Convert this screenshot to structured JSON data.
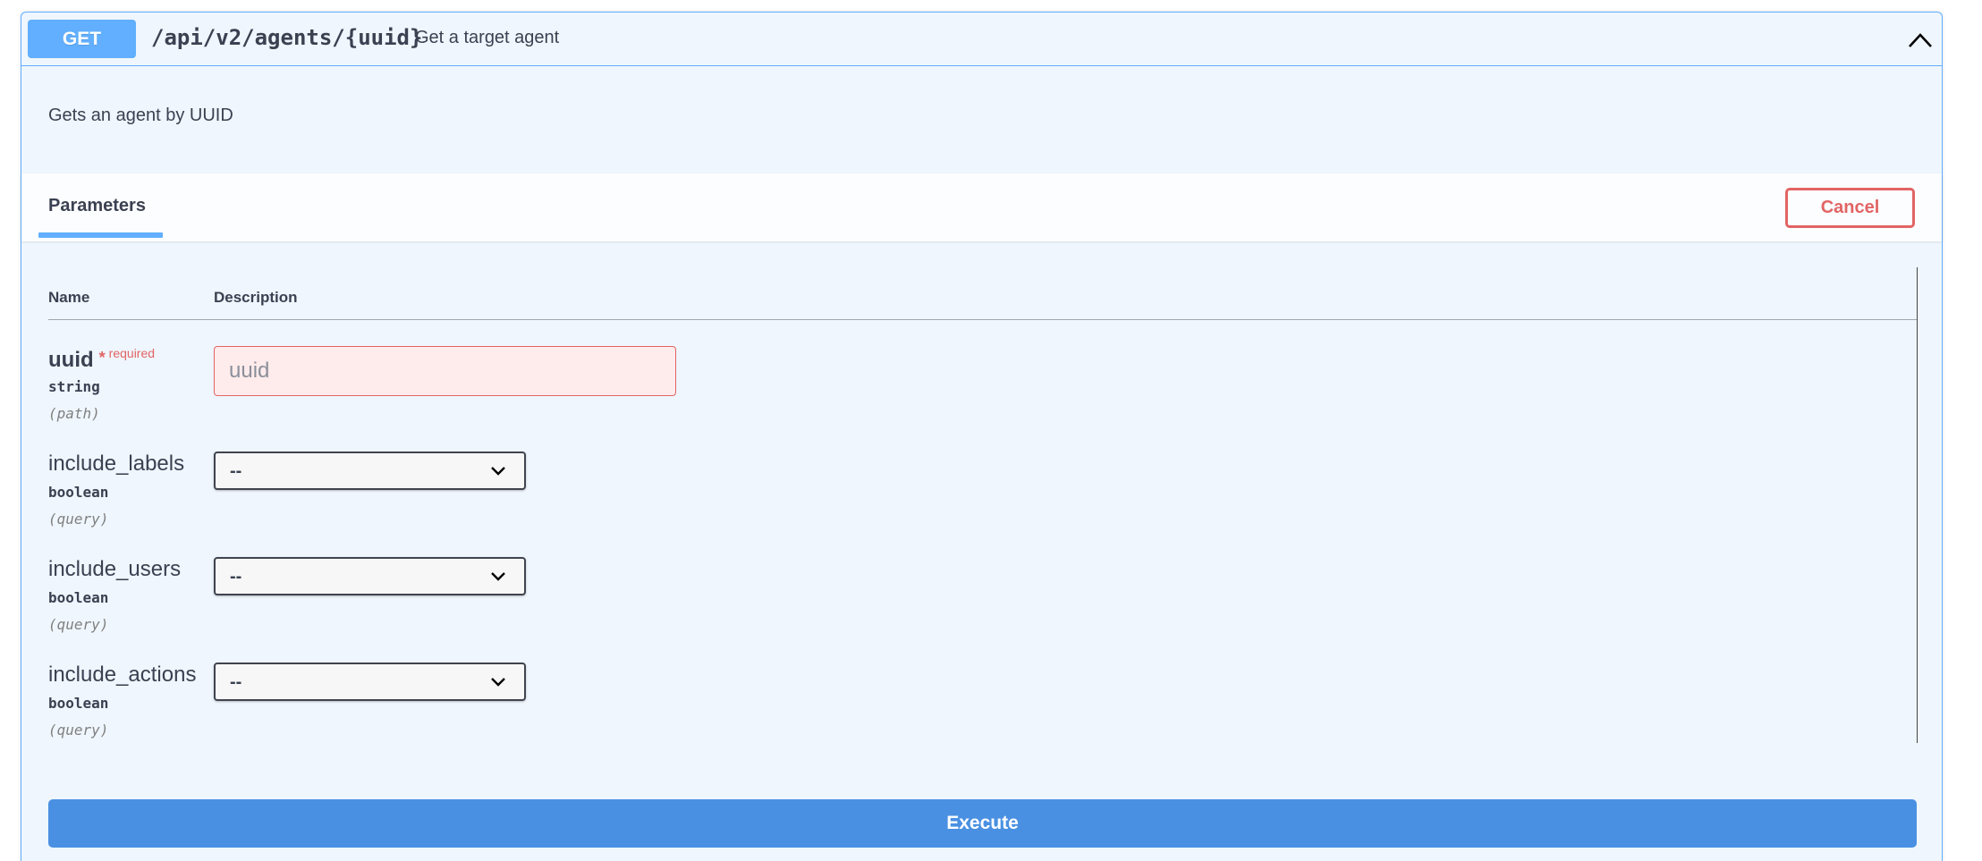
{
  "summary": {
    "method": "GET",
    "path": "/api/v2/agents/{uuid}",
    "description": "Get a target agent",
    "collapse_icon": "chevron-up-icon"
  },
  "description": "Gets an agent by UUID",
  "tabs": {
    "parameters_label": "Parameters",
    "cancel_label": "Cancel"
  },
  "table": {
    "col_name": "Name",
    "col_description": "Description"
  },
  "parameters": [
    {
      "name": "uuid",
      "required_star": "*",
      "required_label": "required",
      "type": "string",
      "in": "(path)",
      "placeholder": "uuid"
    },
    {
      "name": "include_labels",
      "type": "boolean",
      "in": "(query)",
      "value": "--"
    },
    {
      "name": "include_users",
      "type": "boolean",
      "in": "(query)",
      "value": "--"
    },
    {
      "name": "include_actions",
      "type": "boolean",
      "in": "(query)",
      "value": "--"
    }
  ],
  "execute_label": "Execute",
  "colors": {
    "get_accent": "#61affe",
    "required": "#e26464",
    "execute": "#4990e2",
    "panel_bg": "#eff6fd"
  }
}
